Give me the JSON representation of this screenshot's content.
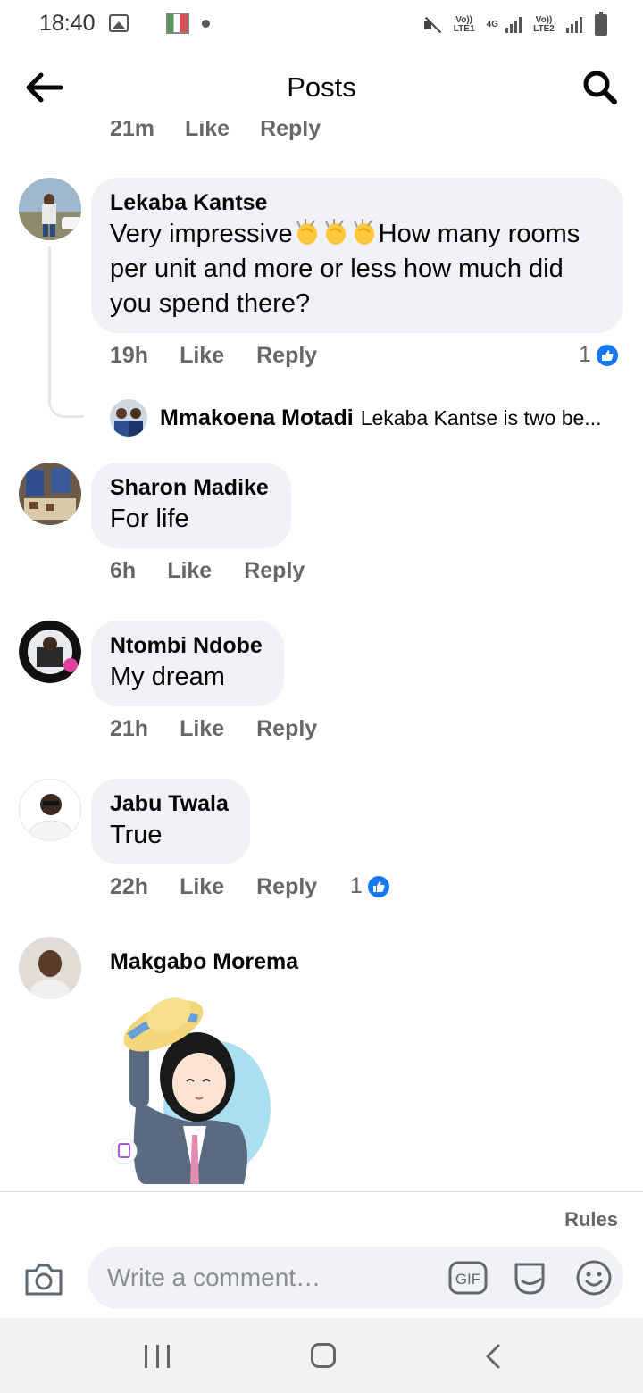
{
  "status_bar": {
    "time": "18:40",
    "net1": "Vo)) LTE1",
    "net_type": "4G",
    "net2": "Vo)) LTE2"
  },
  "header": {
    "title": "Posts",
    "back_icon": "arrow-left-icon",
    "search_icon": "search-icon"
  },
  "partial_actions": {
    "time": "21m",
    "like": "Like",
    "reply": "Reply"
  },
  "comments": [
    {
      "author": "Lekaba Kantse",
      "text_before": "Very impressive",
      "text_after": "How many rooms per unit and more or less how much did you spend there?",
      "emoji": "clapping-hands-icon",
      "time": "19h",
      "like": "Like",
      "reply": "Reply",
      "reactions": "1"
    },
    {
      "author": "Sharon Madike",
      "text": "For life",
      "time": "6h",
      "like": "Like",
      "reply": "Reply"
    },
    {
      "author": "Ntombi Ndobe",
      "text": "My dream",
      "time": "21h",
      "like": "Like",
      "reply": "Reply"
    },
    {
      "author": "Jabu Twala",
      "text": "True",
      "time": "22h",
      "like": "Like",
      "reply": "Reply",
      "reactions": "1"
    },
    {
      "author": "Makgabo Morema"
    }
  ],
  "reply_preview": {
    "author": "Mmakoena Motadi",
    "text": "Lekaba Kantse is two be..."
  },
  "composer": {
    "rules": "Rules",
    "placeholder": "Write a comment…",
    "gif_label": "GIF"
  },
  "colors": {
    "like_blue": "#1877f2",
    "bubble_bg": "#f0f2f5",
    "meta_text": "#65676b"
  }
}
